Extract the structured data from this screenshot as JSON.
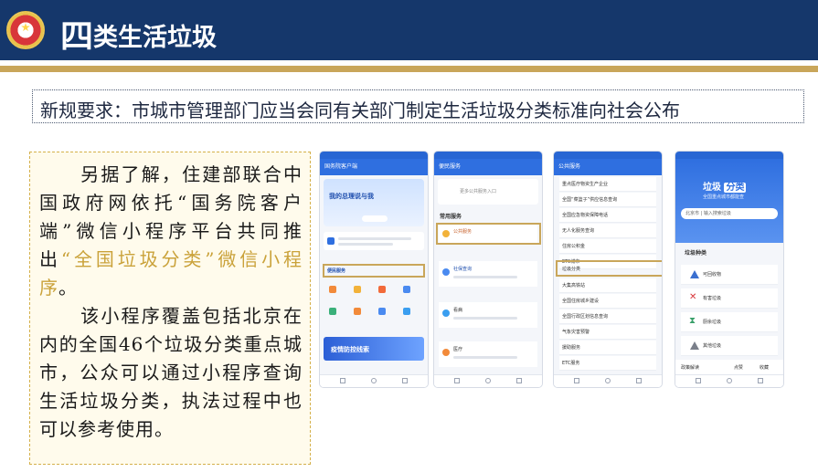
{
  "header": {
    "title_big": "四",
    "title_rest": "类生活垃圾"
  },
  "rule": {
    "text": "新规要求：市城市管理部门应当会同有关部门制定生活垃圾分类标准向社会公布"
  },
  "body": {
    "p1_a": "另据了解，住建部联合中国政府网依托“国务院客户端”微信小程序平台共同推出",
    "p1_hl": "“全国垃圾分类”微信小程序",
    "p1_b": "。",
    "p2": "该小程序覆盖包括北京在内的全国46个垃圾分类重点城市，公众可以通过小程序查询生活垃圾分类，执法过程中也可以参考使用。"
  },
  "phones": {
    "p1": {
      "title": "国务院客户端",
      "banner": "我的总理说与我",
      "section": "便民服务",
      "promo": "疫情防控线索",
      "services": [
        "中小企业",
        "公益服务",
        "就业服务",
        "社保",
        "疫情防控",
        "养老服务",
        "出行服务",
        "健康码"
      ]
    },
    "p2": {
      "title": "便民服务",
      "search": "更多公共服务入口",
      "section": "常用服务",
      "items": [
        "公共服务",
        "社保查询",
        "看病",
        "医疗"
      ]
    },
    "p3": {
      "title": "公共服务",
      "items": [
        "重点医疗物资生产企业",
        "全国“菜篮子”供应信息查询",
        "全国应急物资保障电话",
        "无人化服务查询",
        "住房公积金",
        "ETC城市",
        "垃圾分类",
        "大集高铁站",
        "全国住房城乡建设",
        "全国行政区划信息查询",
        "气象灾害预警",
        "援助服务",
        "ETC服务"
      ]
    },
    "p4": {
      "title_a": "垃圾",
      "title_b": "分类",
      "subtitle": "全国重点城市都能查",
      "search": "北京市 | 输入搜索垃圾",
      "section": "垃圾种类",
      "kinds": [
        "可回收物",
        "有害垃圾",
        "厨余垃圾",
        "其他垃圾"
      ],
      "actions": [
        "政策解读",
        "点赞",
        "收藏"
      ]
    }
  },
  "colors": {
    "header_bg": "#15376b",
    "gold": "#c9a65a",
    "highlight_text": "#caa23a",
    "panel_bg": "#fffbec"
  }
}
